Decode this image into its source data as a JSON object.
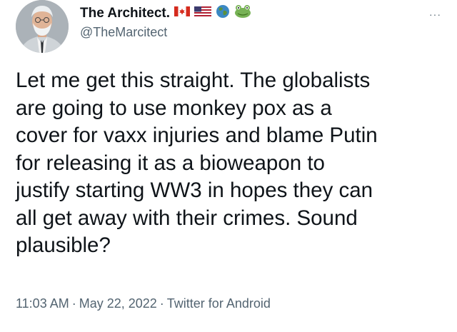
{
  "author": {
    "display_name": "The Architect.",
    "handle": "@TheMarcitect",
    "name_emojis": [
      "canada-flag-icon",
      "usa-flag-icon",
      "earth-globe-icon",
      "frog-icon"
    ]
  },
  "more_menu": {
    "label": "···"
  },
  "tweet": {
    "text": "Let me get this straight. The globalists\nare going to use monkey pox as a\ncover for vaxx injuries and blame Putin\nfor releasing it as a bioweapon to\njustify starting WW3 in hopes they can\nall get away with their crimes. Sound\nplausible?"
  },
  "meta": {
    "time": "11:03 AM",
    "date": "May 22, 2022",
    "source": "Twitter for Android",
    "separator": "·"
  },
  "colors": {
    "text_primary": "#0f1419",
    "text_secondary": "#536471",
    "background": "#ffffff"
  }
}
